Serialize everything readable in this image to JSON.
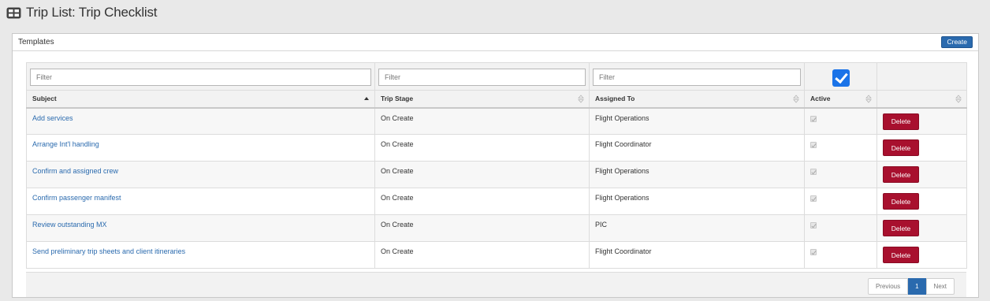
{
  "header": {
    "title": "Trip List: Trip Checklist",
    "icon": "table-grid-icon"
  },
  "panel": {
    "title": "Templates",
    "create_label": "Create"
  },
  "filters": {
    "subject_placeholder": "Filter",
    "stage_placeholder": "Filter",
    "assigned_placeholder": "Filter",
    "active_checked": true
  },
  "columns": {
    "subject": "Subject",
    "stage": "Trip Stage",
    "assigned": "Assigned To",
    "active": "Active",
    "actions": ""
  },
  "rows": [
    {
      "subject": "Add services",
      "stage": "On Create",
      "assigned": "Flight Operations",
      "active": true,
      "action": "Delete"
    },
    {
      "subject": "Arrange Int'l handling",
      "stage": "On Create",
      "assigned": "Flight Coordinator",
      "active": true,
      "action": "Delete"
    },
    {
      "subject": "Confirm and assigned crew",
      "stage": "On Create",
      "assigned": "Flight Operations",
      "active": true,
      "action": "Delete"
    },
    {
      "subject": "Confirm passenger manifest",
      "stage": "On Create",
      "assigned": "Flight Operations",
      "active": true,
      "action": "Delete"
    },
    {
      "subject": "Review outstanding MX",
      "stage": "On Create",
      "assigned": "PIC",
      "active": true,
      "action": "Delete"
    },
    {
      "subject": "Send preliminary trip sheets and client itineraries",
      "stage": "On Create",
      "assigned": "Flight Coordinator",
      "active": true,
      "action": "Delete"
    }
  ],
  "pagination": {
    "previous": "Previous",
    "current": "1",
    "next": "Next"
  },
  "colors": {
    "accent": "#2a6aae",
    "danger": "#a8102e",
    "checkbox": "#1a73e8"
  }
}
